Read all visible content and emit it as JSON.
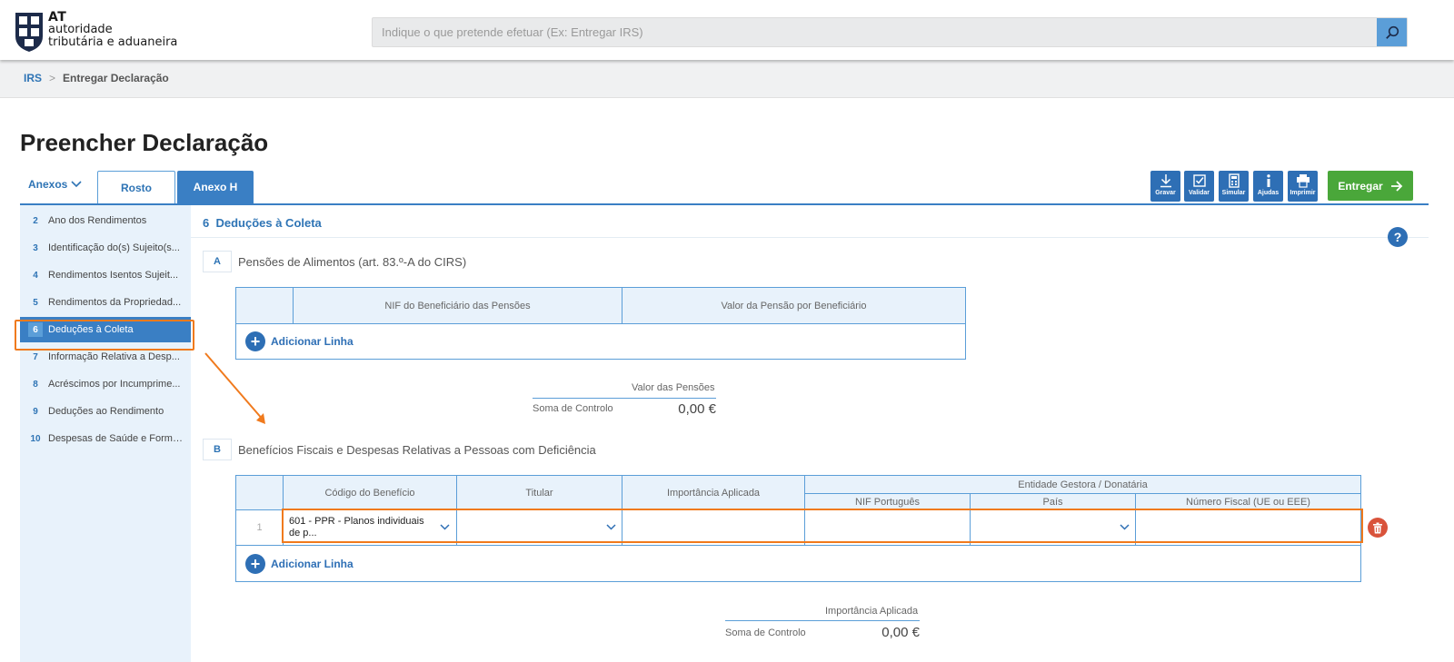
{
  "header": {
    "logo_line1": "AT",
    "logo_line2": "autoridade",
    "logo_line3": "tributária e aduaneira",
    "search_placeholder": "Indique o que pretende efetuar (Ex: Entregar IRS)"
  },
  "breadcrumb": {
    "items": [
      "IRS",
      "Entregar Declaração"
    ],
    "separator": ">"
  },
  "page_title": "Preencher Declaração",
  "tabs": {
    "anexos_label": "Anexos",
    "items": [
      {
        "label": "Rosto",
        "active": false
      },
      {
        "label": "Anexo H",
        "active": true
      }
    ]
  },
  "toolbar": {
    "buttons": [
      {
        "label": "Gravar",
        "icon": "download-icon"
      },
      {
        "label": "Validar",
        "icon": "checkbox-icon"
      },
      {
        "label": "Simular",
        "icon": "calculator-icon"
      },
      {
        "label": "Ajudas",
        "icon": "info-icon"
      },
      {
        "label": "Imprimir",
        "icon": "printer-icon"
      }
    ],
    "submit_label": "Entregar"
  },
  "sidebar": {
    "items": [
      {
        "num": "2",
        "label": "Ano dos Rendimentos"
      },
      {
        "num": "3",
        "label": "Identificação do(s) Sujeito(s..."
      },
      {
        "num": "4",
        "label": "Rendimentos Isentos Sujeit..."
      },
      {
        "num": "5",
        "label": "Rendimentos da Propriedad..."
      },
      {
        "num": "6",
        "label": "Deduções à Coleta",
        "active": true
      },
      {
        "num": "7",
        "label": "Informação Relativa a Desp..."
      },
      {
        "num": "8",
        "label": "Acréscimos por Incumprime..."
      },
      {
        "num": "9",
        "label": "Deduções ao Rendimento"
      },
      {
        "num": "10",
        "label": "Despesas de Saúde e Forma..."
      }
    ]
  },
  "section": {
    "number": "6",
    "title": "Deduções à Coleta",
    "help": "?"
  },
  "subA": {
    "letter": "A",
    "title": "Pensões de Alimentos (art. 83.º-A do CIRS)",
    "headers": [
      "NIF do Beneficiário das Pensões",
      "Valor da Pensão por Beneficiário"
    ],
    "add_line": "Adicionar Linha",
    "control_header": "Valor das Pensões",
    "control_label": "Soma de Controlo",
    "control_value": "0,00 €"
  },
  "subB": {
    "letter": "B",
    "title": "Benefícios Fiscais e Despesas Relativas a Pessoas com Deficiência",
    "headers": {
      "codigo": "Código do Benefício",
      "titular": "Titular",
      "importancia": "Importância Aplicada",
      "entidade": "Entidade Gestora / Donatária",
      "nif": "NIF Português",
      "pais": "País",
      "numero_fiscal": "Número Fiscal (UE ou EEE)"
    },
    "row": {
      "index": "1",
      "codigo_value": "601 - PPR - Planos individuais de p...",
      "titular_value": "",
      "importancia_value": "",
      "nif_value": "",
      "pais_value": "",
      "numero_fiscal_value": ""
    },
    "add_line": "Adicionar Linha",
    "control_header": "Importância Aplicada",
    "control_label": "Soma de Controlo",
    "control_value": "0,00 €"
  },
  "colors": {
    "primary": "#2e6fb5",
    "accent_orange": "#f07a1d",
    "success": "#4aa73a",
    "danger": "#d9533b"
  }
}
